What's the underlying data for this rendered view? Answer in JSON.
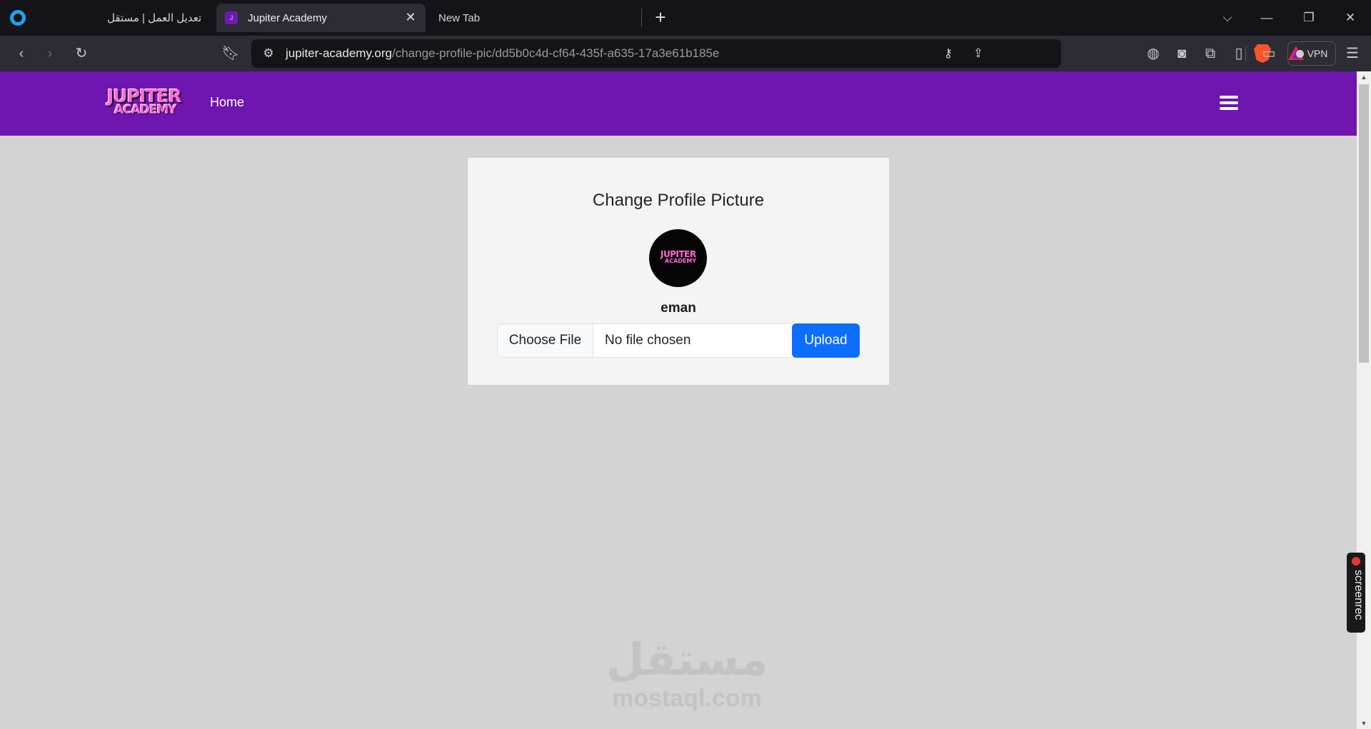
{
  "browser": {
    "tabs": [
      {
        "title": "تعديل العمل | مستقل",
        "active": false
      },
      {
        "title": "Jupiter Academy",
        "active": true
      },
      {
        "title": "New Tab",
        "active": false
      }
    ],
    "new_tab_symbol": "+",
    "close_symbol": "✕",
    "url": {
      "domain": "jupiter-academy.org",
      "path": "/change-profile-pic/dd5b0c4d-cf64-435f-a635-17a3e61b185e"
    },
    "vpn_label": "VPN",
    "accent_color": "#1da2f2"
  },
  "site": {
    "logo": {
      "line1": "JUPITER",
      "line2": "ACADEMY"
    },
    "nav": {
      "home_label": "Home"
    },
    "brand_color": "#6f15b0"
  },
  "card": {
    "title": "Change Profile Picture",
    "avatar": {
      "line1": "JUPITER",
      "line2": "ACADEMY"
    },
    "username": "eman",
    "file_input": {
      "button_label": "Choose File",
      "status": "No file chosen"
    },
    "upload_label": "Upload",
    "upload_color": "#0d6efd"
  },
  "watermark": {
    "arabic": "مستقل",
    "latin": "mostaql.com"
  },
  "overlay": {
    "screenrec_label": "screenrec"
  }
}
